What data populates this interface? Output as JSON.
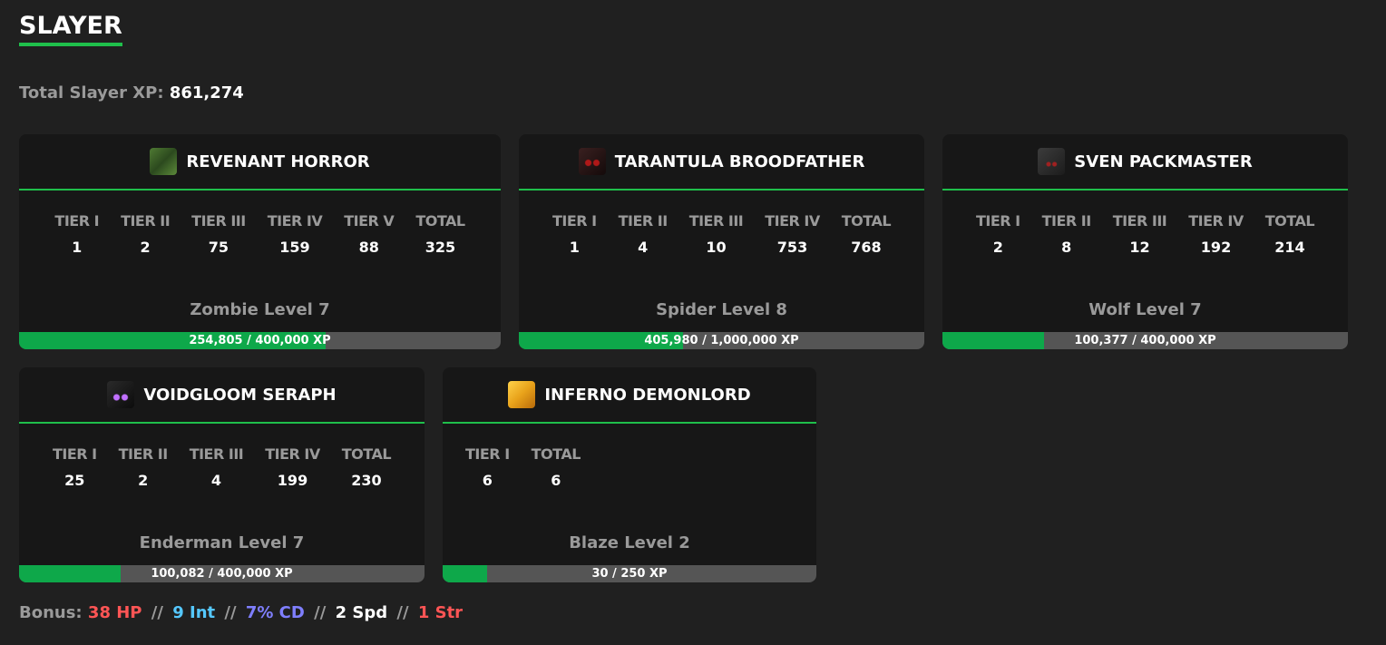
{
  "title": "SLAYER",
  "total_xp": {
    "label": "Total Slayer XP:",
    "value": "861,274"
  },
  "cards": [
    {
      "name": "REVENANT HORROR",
      "icon": "zombie-head-icon",
      "icon_color": "#3a5a2a",
      "tiers": [
        {
          "label": "TIER I",
          "value": "1"
        },
        {
          "label": "TIER II",
          "value": "2"
        },
        {
          "label": "TIER III",
          "value": "75"
        },
        {
          "label": "TIER IV",
          "value": "159"
        },
        {
          "label": "TIER V",
          "value": "88"
        },
        {
          "label": "TOTAL",
          "value": "325"
        }
      ],
      "level": "Zombie Level 7",
      "xp_text": "254,805 / 400,000 XP",
      "progress": 0.637
    },
    {
      "name": "TARANTULA BROODFATHER",
      "icon": "spider-head-icon",
      "icon_color": "#2a1515",
      "tiers": [
        {
          "label": "TIER I",
          "value": "1"
        },
        {
          "label": "TIER II",
          "value": "4"
        },
        {
          "label": "TIER III",
          "value": "10"
        },
        {
          "label": "TIER IV",
          "value": "753"
        },
        {
          "label": "TOTAL",
          "value": "768"
        }
      ],
      "level": "Spider Level 8",
      "xp_text": "405,980 / 1,000,000 XP",
      "progress": 0.406
    },
    {
      "name": "SVEN PACKMASTER",
      "icon": "wolf-head-icon",
      "icon_color": "#2b2b2b",
      "tiers": [
        {
          "label": "TIER I",
          "value": "2"
        },
        {
          "label": "TIER II",
          "value": "8"
        },
        {
          "label": "TIER III",
          "value": "12"
        },
        {
          "label": "TIER IV",
          "value": "192"
        },
        {
          "label": "TOTAL",
          "value": "214"
        }
      ],
      "level": "Wolf Level 7",
      "xp_text": "100,377 / 400,000 XP",
      "progress": 0.251
    },
    {
      "name": "VOIDGLOOM SERAPH",
      "icon": "enderman-head-icon",
      "icon_color": "#1a1a1a",
      "tiers": [
        {
          "label": "TIER I",
          "value": "25"
        },
        {
          "label": "TIER II",
          "value": "2"
        },
        {
          "label": "TIER III",
          "value": "4"
        },
        {
          "label": "TIER IV",
          "value": "199"
        },
        {
          "label": "TOTAL",
          "value": "230"
        }
      ],
      "level": "Enderman Level 7",
      "xp_text": "100,082 / 400,000 XP",
      "progress": 0.25
    },
    {
      "name": "INFERNO DEMONLORD",
      "icon": "blaze-head-icon",
      "icon_color": "#e8a21a",
      "tiers": [
        {
          "label": "TIER I",
          "value": "6"
        },
        {
          "label": "TOTAL",
          "value": "6"
        }
      ],
      "level": "Blaze Level 2",
      "xp_text": "30 / 250 XP",
      "progress": 0.12
    }
  ],
  "bonus": {
    "label": "Bonus:",
    "separator": "//",
    "items": [
      {
        "text": "38 HP",
        "color": "#ff5555"
      },
      {
        "text": "9 Int",
        "color": "#55c8ff"
      },
      {
        "text": "7% CD",
        "color": "#7f7fff"
      },
      {
        "text": "2 Spd",
        "color": "#ffffff"
      },
      {
        "text": "1 Str",
        "color": "#ff5555"
      }
    ]
  }
}
